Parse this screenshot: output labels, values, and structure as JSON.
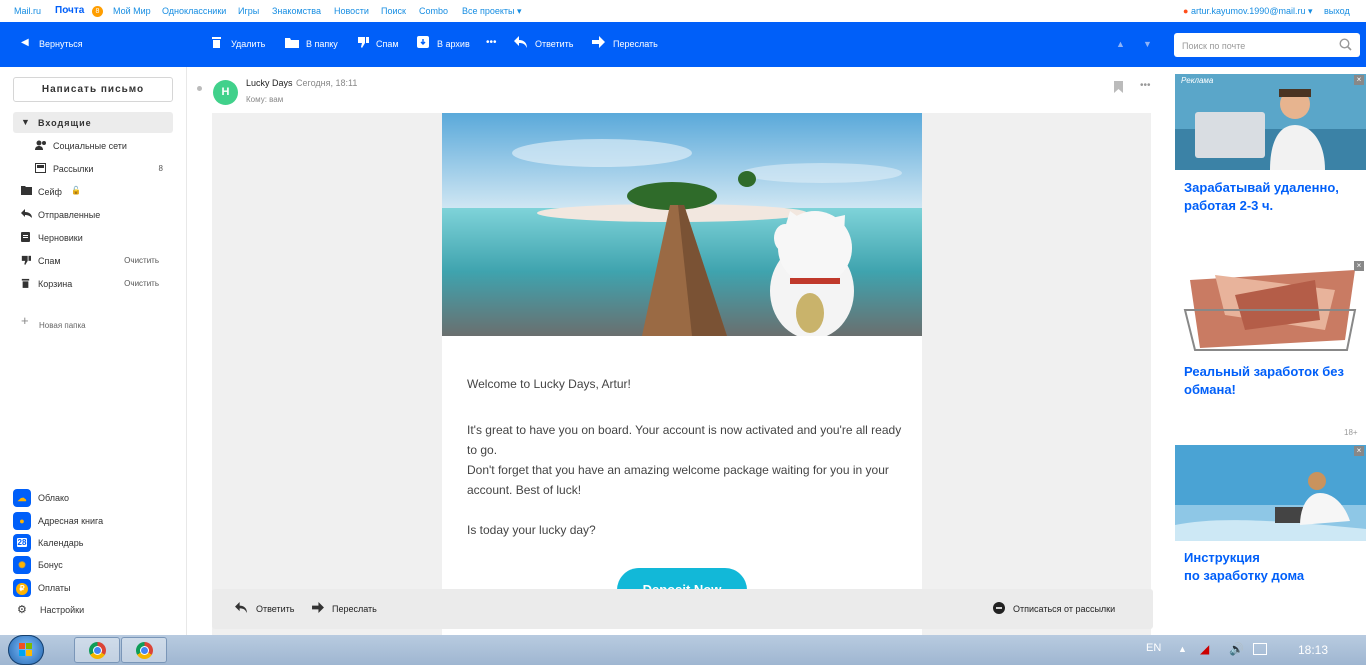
{
  "topnav": {
    "links": [
      "Mail.ru",
      "Почта",
      "Мой Мир",
      "Одноклассники",
      "Игры",
      "Знакомства",
      "Новости",
      "Поиск",
      "Combo",
      "Все проекты ▾"
    ],
    "mail_badge": "8",
    "user": "artur.kayumov.1990@mail.ru ▾",
    "logout": "выход"
  },
  "toolbar": {
    "back": "Вернуться",
    "delete": "Удалить",
    "to_folder": "В папку",
    "spam": "Спам",
    "archive": "В архив",
    "more": "•••",
    "reply": "Ответить",
    "forward": "Переслать",
    "search_placeholder": "Поиск по почте"
  },
  "sidebar": {
    "compose": "Написать письмо",
    "inbox": "Входящие",
    "social": "Социальные сети",
    "newsletters": "Рассылки",
    "newsletters_count": "8",
    "safe": "Сейф",
    "sent": "Отправленные",
    "drafts": "Черновики",
    "spam": "Спам",
    "spam_clear": "Очистить",
    "trash": "Корзина",
    "trash_clear": "Очистить",
    "new_folder": "Новая папка",
    "apps": [
      {
        "label": "Облако",
        "icon": "cloud-icon",
        "glyph": "☁",
        "color": "#ff6a00"
      },
      {
        "label": "Адресная книга",
        "icon": "contacts-icon",
        "glyph": "👤",
        "color": "#005ff9"
      },
      {
        "label": "Календарь",
        "icon": "calendar-icon",
        "glyph": "28",
        "color": "#005ff9"
      },
      {
        "label": "Бонус",
        "icon": "bonus-icon",
        "glyph": "%",
        "color": "#ffb300"
      },
      {
        "label": "Оплаты",
        "icon": "payments-icon",
        "glyph": "₽",
        "color": "#ff9e00"
      }
    ],
    "settings": "Настройки"
  },
  "message": {
    "avatar_letter": "H",
    "sender": "Lucky Days",
    "date": "Сегодня, 18:11",
    "to": "Кому: вам",
    "greeting": "Welcome to Lucky Days, Artur!",
    "p1": "It's great to have you on board. Your account is now activated and you're all ready to go.",
    "p2": "Don't forget that you have an amazing welcome package waiting for you in your account. Best of luck!",
    "p3": "Is today your lucky day?",
    "cta": "Deposit Now"
  },
  "bottombar": {
    "reply": "Ответить",
    "forward": "Переслать",
    "unsubscribe": "Отписаться от рассылки"
  },
  "ads": {
    "label": "Реклама",
    "ad1": "Зарабатывай удаленно, работая 2-3 ч.",
    "ad2": "Реальный заработок без обмана!",
    "age": "18+",
    "ad3_l1": "Инструкция",
    "ad3_l2": "по заработку дома",
    "close": "×"
  },
  "taskbar": {
    "lang": "EN",
    "clock": "18:13"
  },
  "colors": {
    "accent": "#005ff9",
    "cta": "#12b8d8",
    "avatar": "#41d18b"
  }
}
